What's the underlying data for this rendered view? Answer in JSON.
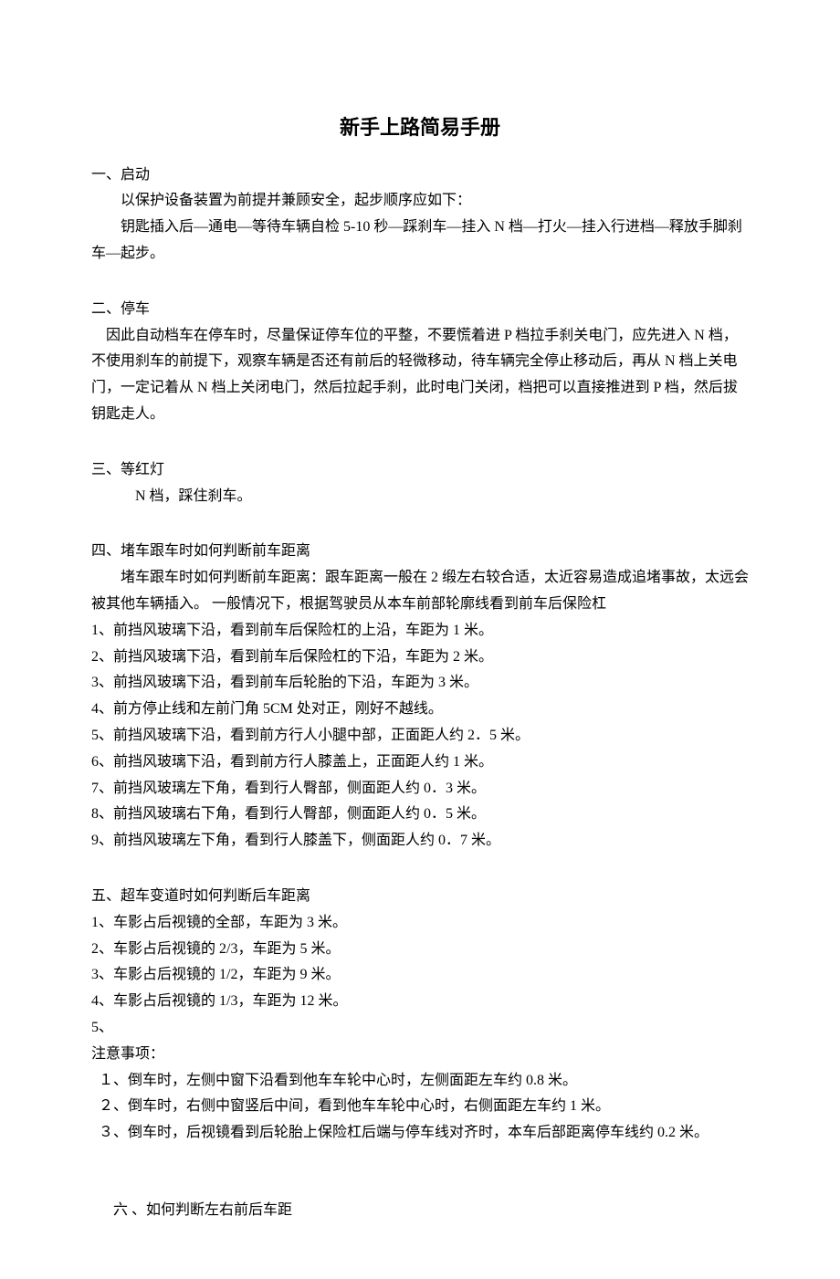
{
  "title": "新手上路简易手册",
  "sections": {
    "s1": {
      "heading": "一、启动",
      "p1": "以保护设备装置为前提并兼顾安全，起步顺序应如下：",
      "p2": "钥匙插入后—通电—等待车辆自检 5-10 秒—踩刹车—挂入 N 档—打火—挂入行进档—释放手脚刹车—起步。"
    },
    "s2": {
      "heading": "二、停车",
      "p1": "因此自动档车在停车时，尽量保证停车位的平整，不要慌着进 P 档拉手刹关电门，应先进入 N 档，不使用刹车的前提下，观察车辆是否还有前后的轻微移动，待车辆完全停止移动后，再从 N 档上关电门，一定记着从 N 档上关闭电门，然后拉起手刹，此时电门关闭，档把可以直接推进到 P 档，然后拔钥匙走人。"
    },
    "s3": {
      "heading": "三、等红灯",
      "p1": "N 档，踩住刹车。"
    },
    "s4": {
      "heading": "四、堵车跟车时如何判断前车距离",
      "p1": "堵车跟车时如何判断前车距离：跟车距离一般在 2 缎左右较合适，太近容易造成追堵事故，太远会被其他车辆插入。 一般情况下，根据驾驶员从本车前部轮廓线看到前车后保险杠",
      "items": {
        "i1": "1、前挡风玻璃下沿，看到前车后保险杠的上沿，车距为 1 米。",
        "i2": "2、前挡风玻璃下沿，看到前车后保险杠的下沿，车距为 2 米。",
        "i3": "3、前挡风玻璃下沿，看到前车后轮胎的下沿，车距为 3 米。",
        "i4": "4、前方停止线和左前门角 5CM 处对正，刚好不越线。",
        "i5": "5、前挡风玻璃下沿，看到前方行人小腿中部，正面距人约 2．5 米。",
        "i6": "6、前挡风玻璃下沿，看到前方行人膝盖上，正面距人约 1 米。",
        "i7": "7、前挡风玻璃左下角，看到行人臀部，侧面距人约 0．3 米。",
        "i8": "8、前挡风玻璃右下角，看到行人臀部，侧面距人约 0．5 米。",
        "i9": "9、前挡风玻璃左下角，看到行人膝盖下，侧面距人约 0．7 米。"
      }
    },
    "s5": {
      "heading": "五、超车变道时如何判断后车距离",
      "items": {
        "i1": "1、车影占后视镜的全部，车距为 3 米。",
        "i2": "2、车影占后视镜的 2/3，车距为 5 米。",
        "i3": "3、车影占后视镜的 1/2，车距为 9 米。",
        "i4": "4、车影占后视镜的 1/3，车距为 12 米。",
        "i5": "5、"
      },
      "note_heading": "注意事项：",
      "notes": {
        "n1": "１、倒车时，左侧中窗下沿看到他车车轮中心时，左侧面距左车约 0.8 米。",
        "n2": "２、倒车时，右侧中窗竖后中间，看到他车车轮中心时，右侧面距左车约 1 米。",
        "n3": "３、倒车时，后视镜看到后轮胎上保险杠后端与停车线对齐时，本车后部距离停车线约 0.2 米。"
      }
    },
    "s6": {
      "heading": "六 、如何判断左右前后车距"
    }
  }
}
